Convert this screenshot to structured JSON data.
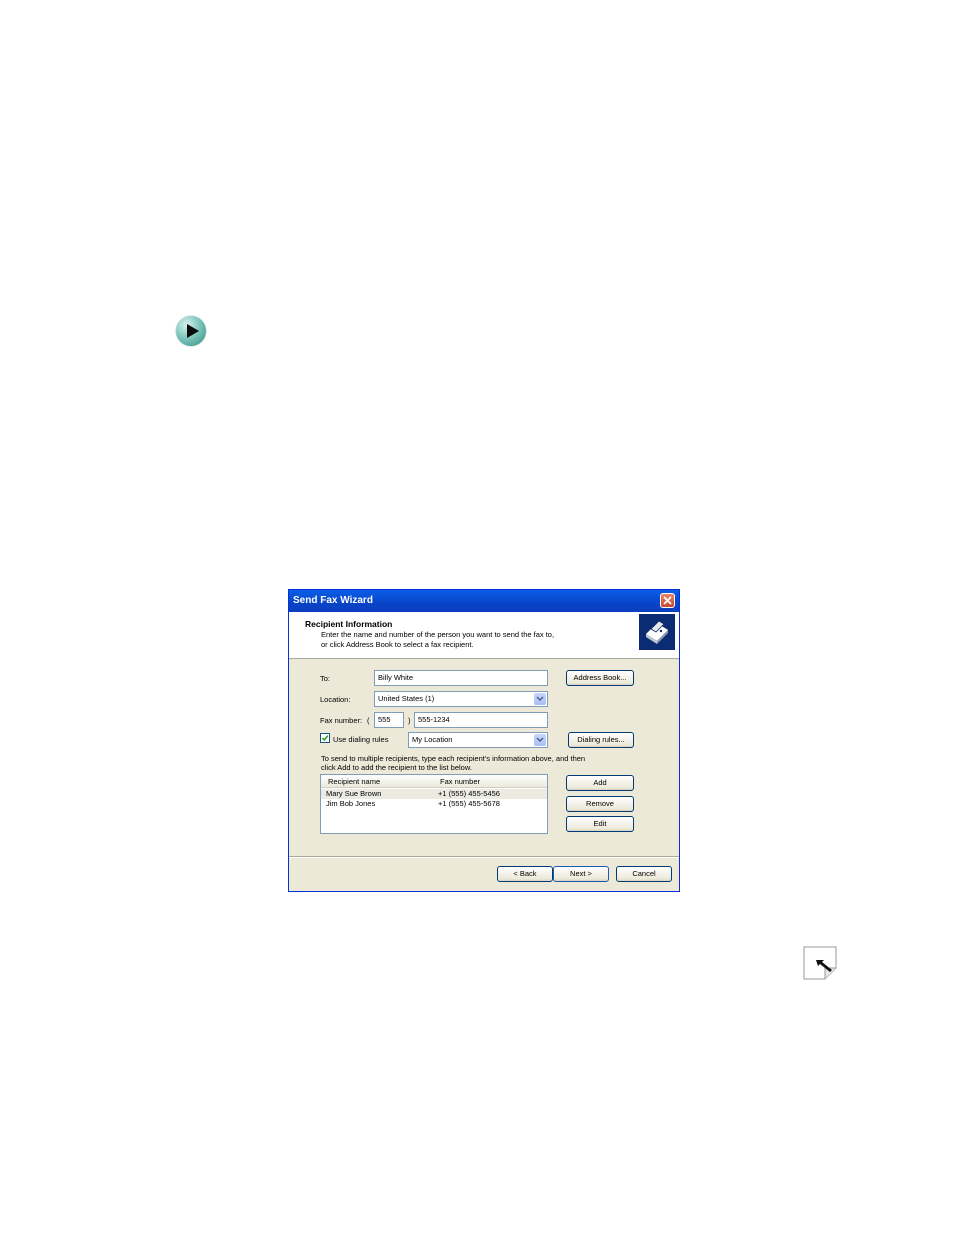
{
  "dialog": {
    "title": "Send Fax Wizard",
    "header": {
      "title": "Recipient Information",
      "subtitle_line1": "Enter the name and number of the person you want to send the fax to,",
      "subtitle_line2": "or click Address Book to select a fax recipient."
    },
    "to": {
      "label": "To:",
      "value": "Billy White"
    },
    "location": {
      "label": "Location:",
      "value": "United States (1)"
    },
    "fax_number": {
      "label": "Fax number:",
      "paren_open": "(",
      "area_code": "555",
      "paren_close": ")",
      "number": "555-1234"
    },
    "dialing_rules": {
      "label": "Use dialing rules",
      "checked": true,
      "value": "My Location"
    },
    "note_line1": "To send to multiple recipients, type each recipient's information above, and then",
    "note_line2": "click Add to add the recipient to the list below.",
    "list": {
      "columns": [
        "Recipient name",
        "Fax number"
      ],
      "rows": [
        {
          "name": "Mary Sue Brown",
          "fax": "+1 (555) 455-5456"
        },
        {
          "name": "Jim Bob Jones",
          "fax": "+1 (555) 455-5678"
        }
      ]
    },
    "buttons": {
      "address_book": "Address Book...",
      "dialing_rules": "Dialing rules...",
      "add": "Add",
      "remove": "Remove",
      "edit": "Edit",
      "back": "< Back",
      "next": "Next >",
      "cancel": "Cancel"
    }
  },
  "icons": {
    "step_arrow": "play-arrow-icon",
    "fax": "fax-machine-icon",
    "close": "close-icon",
    "corner": "cursor-arrow-icon"
  },
  "colors": {
    "titlebar": "#0a4fd6",
    "dialog_bg": "#ece9d8",
    "close_button": "#d4573a",
    "step_icon": "#3d9a8d"
  }
}
